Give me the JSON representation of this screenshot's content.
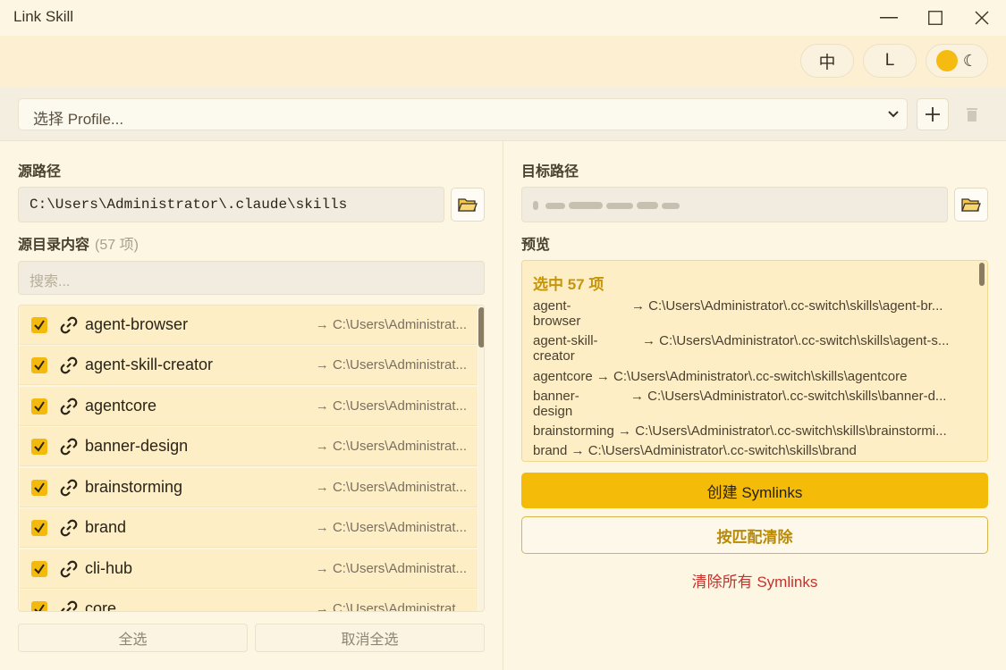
{
  "window": {
    "title": "Link Skill"
  },
  "topbar": {
    "lang_label": "中",
    "size_label": "L",
    "theme_icon": "sun-moon-toggle"
  },
  "profile": {
    "placeholder": "选择 Profile...",
    "add_label": "+"
  },
  "source": {
    "label": "源路径",
    "path": "C:\\Users\\Administrator\\.claude\\skills",
    "contents_label": "源目录内容",
    "count_label": "(57 项)",
    "search_placeholder": "搜索...",
    "items": [
      {
        "name": "agent-browser",
        "dest": "→ C:\\Users\\Administrat..."
      },
      {
        "name": "agent-skill-creator",
        "dest": "→ C:\\Users\\Administrat..."
      },
      {
        "name": "agentcore",
        "dest": "→ C:\\Users\\Administrat..."
      },
      {
        "name": "banner-design",
        "dest": "→ C:\\Users\\Administrat..."
      },
      {
        "name": "brainstorming",
        "dest": "→ C:\\Users\\Administrat..."
      },
      {
        "name": "brand",
        "dest": "→ C:\\Users\\Administrat..."
      },
      {
        "name": "cli-hub",
        "dest": "→ C:\\Users\\Administrat..."
      },
      {
        "name": "core",
        "dest": "→ C:\\Users\\Administrat..."
      }
    ],
    "select_all": "全选",
    "deselect_all": "取消全选"
  },
  "target": {
    "label": "目标路径",
    "preview_label": "预览",
    "selected_label": "选中 57 项",
    "preview_items": [
      {
        "name_1": "agent-",
        "name_2": "browser",
        "dest": "→ C:\\Users\\Administrator\\.cc-switch\\skills\\agent-br..."
      },
      {
        "name_1": "agent-skill-",
        "name_2": "creator",
        "dest": "→ C:\\Users\\Administrator\\.cc-switch\\skills\\agent-s..."
      },
      {
        "name_1": "agentcore",
        "name_2": "",
        "dest": "→ C:\\Users\\Administrator\\.cc-switch\\skills\\agentcore"
      },
      {
        "name_1": "banner-",
        "name_2": "design",
        "dest": "→ C:\\Users\\Administrator\\.cc-switch\\skills\\banner-d..."
      },
      {
        "name_1": "brainstorming",
        "name_2": "",
        "dest": "→ C:\\Users\\Administrator\\.cc-switch\\skills\\brainstormi..."
      },
      {
        "name_1": "brand",
        "name_2": "",
        "dest": "→ C:\\Users\\Administrator\\.cc-switch\\skills\\brand"
      }
    ],
    "create_label": "创建 Symlinks",
    "clean_match_label": "按匹配清除",
    "clean_all_label": "清除所有 Symlinks"
  },
  "colors": {
    "accent": "#f4bb08",
    "danger": "#c8302a",
    "background": "#fdf6e3"
  }
}
